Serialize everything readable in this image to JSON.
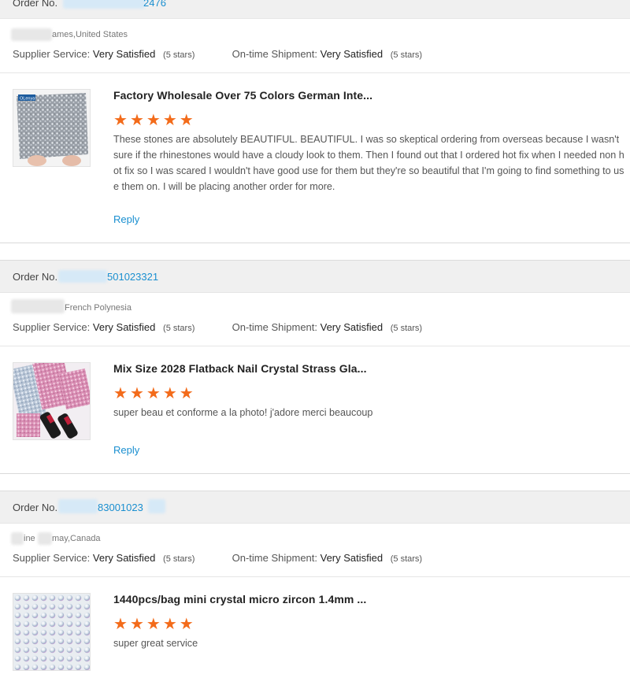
{
  "order_label": "Order No.",
  "orders": [
    {
      "number_partial": "2476",
      "buyer_location": "ames,United States",
      "supplier_label": "Supplier Service:",
      "supplier_value": "Very Satisfied",
      "supplier_stars": "(5 stars)",
      "shipment_label": "On-time Shipment:",
      "shipment_value": "Very Satisfied",
      "shipment_stars": "(5 stars)",
      "product_title": "Factory Wholesale Over 75 Colors German Inte...",
      "rating": 5,
      "review_text": "These stones are absolutely BEAUTIFUL. BEAUTIFUL. I was so skeptical ordering from overseas because I wasn't sure if the rhinestones would have a cloudy look to them. Then I found out that I ordered hot fix when I needed non hot fix so I was scared I wouldn't have good use for them but they're so beautiful that I'm going to find something to use them on. I will be placing another order for more.",
      "reply_label": "Reply",
      "thumb_brand": "OLenya"
    },
    {
      "number_partial": "501023321",
      "buyer_location": "French Polynesia",
      "supplier_label": "Supplier Service:",
      "supplier_value": "Very Satisfied",
      "supplier_stars": "(5 stars)",
      "shipment_label": "On-time Shipment:",
      "shipment_value": "Very Satisfied",
      "shipment_stars": "(5 stars)",
      "product_title": "Mix Size 2028 Flatback Nail Crystal Strass Gla...",
      "rating": 5,
      "review_text": "super beau et conforme a la photo! j'adore merci beaucoup",
      "reply_label": "Reply"
    },
    {
      "number_partial": "83001023",
      "buyer_location": "may,Canada",
      "buyer_prefix": "ine",
      "supplier_label": "Supplier Service:",
      "supplier_value": "Very Satisfied",
      "supplier_stars": "(5 stars)",
      "shipment_label": "On-time Shipment:",
      "shipment_value": "Very Satisfied",
      "shipment_stars": "(5 stars)",
      "product_title": "1440pcs/bag mini crystal micro zircon 1.4mm ...",
      "rating": 5,
      "review_text": "super great service"
    }
  ],
  "colors": {
    "link": "#1a8fd0",
    "star": "#f36b1a",
    "bar": "#f0f0f0"
  }
}
